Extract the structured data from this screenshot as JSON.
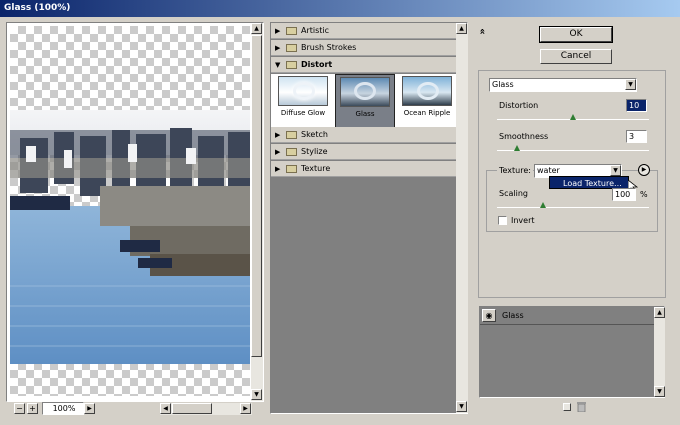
{
  "window": {
    "title": "Glass (100%)"
  },
  "preview": {
    "zoom": "100%",
    "zoom_minus": "−",
    "zoom_plus": "+"
  },
  "gallery": {
    "categories": {
      "artistic": "Artistic",
      "brush_strokes": "Brush Strokes",
      "distort": "Distort",
      "sketch": "Sketch",
      "stylize": "Stylize",
      "texture": "Texture"
    },
    "distort_filters": [
      "Diffuse Glow",
      "Glass",
      "Ocean Ripple"
    ],
    "collapse_label": "«"
  },
  "buttons": {
    "ok": "OK",
    "cancel": "Cancel"
  },
  "settings": {
    "filter_select": "Glass",
    "distortion_label": "Distortion",
    "distortion_value": "10",
    "distortion_level": 0.5,
    "smoothness_label": "Smoothness",
    "smoothness_value": "3",
    "smoothness_level": 0.13,
    "texture_label": "Texture:",
    "texture_value": "water",
    "load_texture_item": "Load Texture...",
    "scaling_label": "Scaling",
    "scaling_value": "100",
    "scaling_unit": "%",
    "scaling_level": 0.3,
    "invert_label": "Invert",
    "invert_checked": false
  },
  "layers": {
    "items": [
      "Glass"
    ]
  },
  "colors": {
    "titlebar_start": "#0a246a",
    "titlebar_end": "#a6caf0",
    "selection": "#0a246a",
    "gallery_bg": "#808080",
    "slider_knob": "#2e7d32"
  }
}
